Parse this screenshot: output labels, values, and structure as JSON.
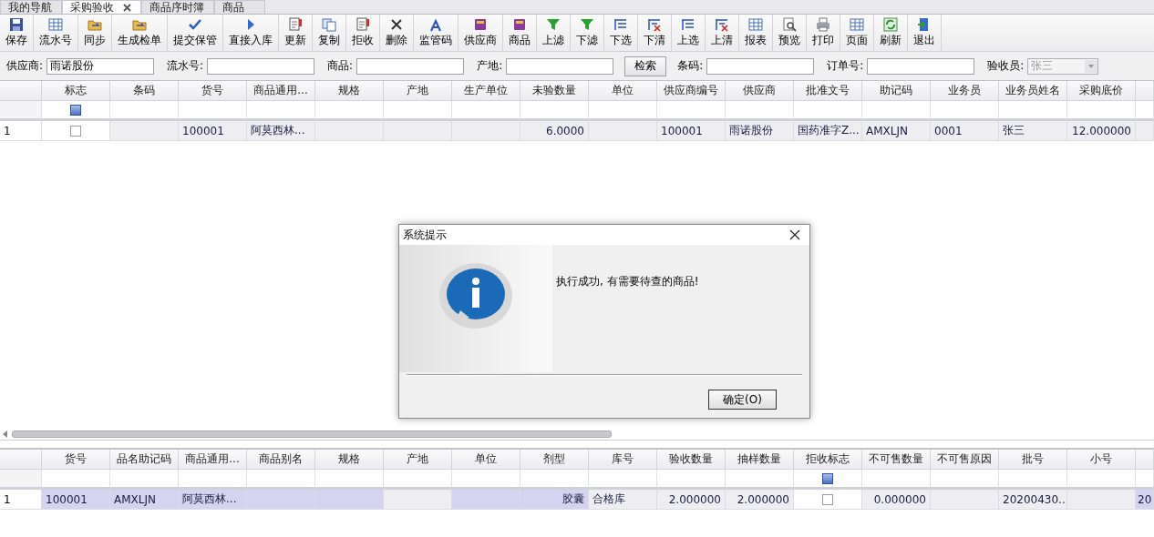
{
  "tabs": [
    {
      "label": "我的导航",
      "selected": false,
      "closable": false
    },
    {
      "label": "采购验收",
      "selected": true,
      "closable": true
    },
    {
      "label": "商品序时簿",
      "selected": false,
      "closable": false
    },
    {
      "label": "商品",
      "selected": false,
      "closable": false
    }
  ],
  "toolbar": [
    {
      "label": "保存",
      "kind": "floppy"
    },
    {
      "label": "流水号",
      "kind": "table"
    },
    {
      "label": "同步",
      "kind": "folder"
    },
    {
      "label": "生成检单",
      "kind": "folder"
    },
    {
      "label": "提交保管",
      "kind": "check"
    },
    {
      "label": "直接入库",
      "kind": "play"
    },
    {
      "label": "更新",
      "kind": "document"
    },
    {
      "label": "复制",
      "kind": "copy"
    },
    {
      "label": "拒收",
      "kind": "document"
    },
    {
      "label": "删除",
      "kind": "cross"
    },
    {
      "label": "监管码",
      "kind": "letter"
    },
    {
      "label": "供应商",
      "kind": "book"
    },
    {
      "label": "商品",
      "kind": "book"
    },
    {
      "label": "上滤",
      "kind": "funnel"
    },
    {
      "label": "下滤",
      "kind": "funnel"
    },
    {
      "label": "下选",
      "kind": "list"
    },
    {
      "label": "下清",
      "kind": "listx"
    },
    {
      "label": "上选",
      "kind": "list"
    },
    {
      "label": "上清",
      "kind": "listx"
    },
    {
      "label": "报表",
      "kind": "table"
    },
    {
      "label": "预览",
      "kind": "magnifier"
    },
    {
      "label": "打印",
      "kind": "printer"
    },
    {
      "label": "页面",
      "kind": "table"
    },
    {
      "label": "刷新",
      "kind": "refresh"
    },
    {
      "label": "退出",
      "kind": "door"
    }
  ],
  "filter_bar": {
    "fields": [
      {
        "label": "供应商:",
        "value": "雨诺股份"
      },
      {
        "label": "流水号:"
      },
      {
        "label": "商品:"
      },
      {
        "label": "产地:"
      }
    ],
    "search_button": "检索",
    "fields_after": [
      {
        "label": "条码:"
      },
      {
        "label": "订单号:"
      }
    ],
    "receiver": {
      "label": "验收员:",
      "value": "张三",
      "disabled": true
    }
  },
  "top_table": {
    "columns": [
      {
        "label": "标志",
        "kind": "checkbox"
      },
      {
        "label": "条码"
      },
      {
        "label": "货号"
      },
      {
        "label": "商品通用..."
      },
      {
        "label": "规格"
      },
      {
        "label": "产地"
      },
      {
        "label": "生产单位"
      },
      {
        "label": "未验数量",
        "kind": "number"
      },
      {
        "label": "单位"
      },
      {
        "label": "供应商编号"
      },
      {
        "label": "供应商"
      },
      {
        "label": "批准文号"
      },
      {
        "label": "助记码"
      },
      {
        "label": "业务员"
      },
      {
        "label": "业务员姓名"
      },
      {
        "label": "采购底价",
        "kind": "number"
      },
      {}
    ],
    "rows": [
      {
        "number": "1",
        "cells": [
          {
            "checked": false
          },
          {},
          {
            "text": "100001"
          },
          {
            "text": "阿莫西林..."
          },
          {},
          {},
          {},
          {
            "text": "6.0000"
          },
          {},
          {
            "text": "100001"
          },
          {
            "text": "雨诺股份"
          },
          {
            "text": "国药准字Z..."
          },
          {
            "text": "AMXLJN"
          },
          {
            "text": "0001"
          },
          {
            "text": "张三"
          },
          {
            "text": "12.000000"
          },
          {}
        ]
      }
    ]
  },
  "bottom_table": {
    "columns": [
      {
        "label": "货号"
      },
      {
        "label": "品名助记码"
      },
      {
        "label": "商品通用..."
      },
      {
        "label": "商品别名"
      },
      {
        "label": "规格"
      },
      {
        "label": "产地"
      },
      {
        "label": "单位"
      },
      {
        "label": "剂型",
        "kind": "number"
      },
      {
        "label": "库号"
      },
      {
        "label": "验收数量",
        "kind": "number"
      },
      {
        "label": "抽样数量",
        "kind": "number"
      },
      {
        "label": "拒收标志",
        "kind": "checkbox"
      },
      {
        "label": "不可售数量",
        "kind": "number"
      },
      {
        "label": "不可售原因"
      },
      {
        "label": "批号"
      },
      {
        "label": "小号"
      },
      {}
    ],
    "rows": [
      {
        "number": "1",
        "cells": [
          {
            "text": "100001",
            "highlighted": true
          },
          {
            "text": "AMXLJN",
            "highlighted": true
          },
          {
            "text": "阿莫西林...",
            "highlighted": true
          },
          {
            "highlighted": true
          },
          {
            "highlighted": true
          },
          {
            "highlighted": false
          },
          {
            "highlighted": true
          },
          {
            "text": "胶囊",
            "highlighted": true
          },
          {
            "text": "合格库",
            "highlighted": false
          },
          {
            "text": "2.000000",
            "highlighted": false
          },
          {
            "text": "2.000000",
            "highlighted": false
          },
          {
            "checked": false,
            "highlighted": false
          },
          {
            "text": "0.000000",
            "highlighted": false
          },
          {
            "highlighted": false
          },
          {
            "text": "20200430...",
            "highlighted": false
          },
          {
            "highlighted": false
          },
          {
            "text": "20",
            "highlighted": true
          }
        ]
      }
    ]
  },
  "dialog": {
    "title": "系统提示",
    "message": "执行成功, 有需要待查的商品!",
    "button": "确定(O)"
  }
}
